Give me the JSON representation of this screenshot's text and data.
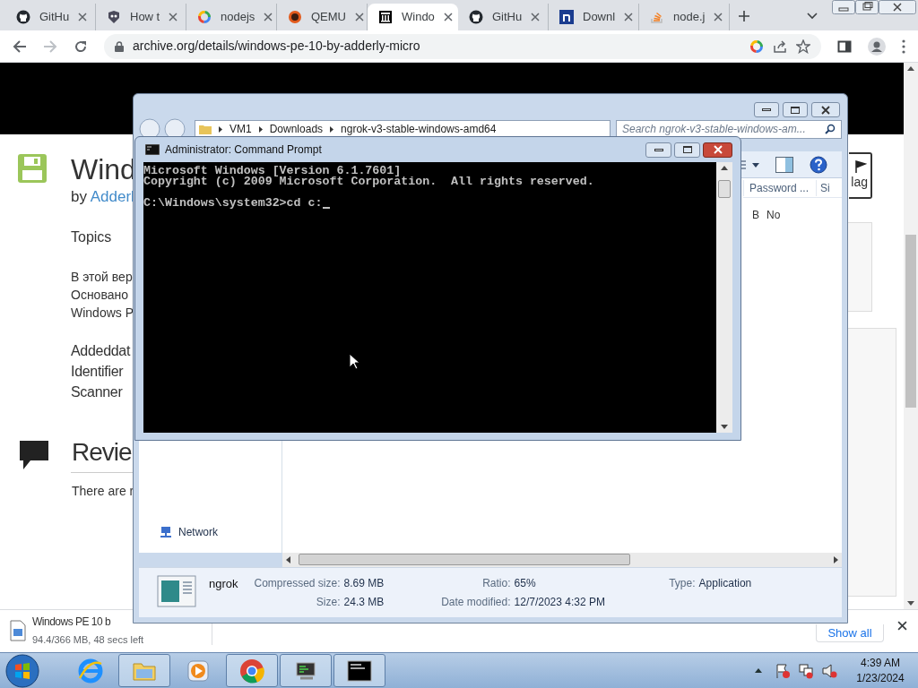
{
  "browser": {
    "tabs": [
      {
        "label": "GitHu",
        "kind": "github",
        "selected": false
      },
      {
        "label": "How t",
        "kind": "mask",
        "selected": false
      },
      {
        "label": "nodejs",
        "kind": "google",
        "selected": false
      },
      {
        "label": "QEMU",
        "kind": "qemu",
        "selected": false
      },
      {
        "label": "Windo",
        "kind": "archive",
        "selected": true
      },
      {
        "label": "GitHu",
        "kind": "github",
        "selected": false
      },
      {
        "label": "Downl",
        "kind": "nsquare",
        "selected": false
      },
      {
        "label": "node.j",
        "kind": "stack",
        "selected": false
      }
    ],
    "address": "archive.org/details/windows-pe-10-by-adderly-micro",
    "page": {
      "title": "Wind",
      "byline": "by",
      "author": "Adderl",
      "topics_label": "Topics",
      "description": [
        "В этой вер",
        "Основано",
        "Windows P"
      ],
      "metadata_labels": [
        "Addeddat",
        "Identifier",
        "Scanner"
      ],
      "reviews_heading": "Revie",
      "reviews_text": "There are r",
      "flag_button": "lag"
    },
    "download": {
      "filename": "Windows PE 10 b",
      "progress": "94.4/366 MB, 48 secs left",
      "show_all": "Show all"
    }
  },
  "explorer": {
    "breadcrumb": [
      "VM1",
      "Downloads",
      "ngrok-v3-stable-windows-amd64"
    ],
    "search_placeholder": "Search ngrok-v3-stable-windows-am...",
    "columns": [
      "Password ...",
      "Si"
    ],
    "row_cells": [
      "B",
      "No"
    ],
    "nav_items": [
      "Network"
    ],
    "details": {
      "name": "ngrok",
      "columns": [
        [
          {
            "label": "Compressed size:",
            "value": "8.69 MB"
          },
          {
            "label": "Size:",
            "value": "24.3 MB"
          }
        ],
        [
          {
            "label": "Ratio:",
            "value": "65%"
          },
          {
            "label": "Date modified:",
            "value": "12/7/2023 4:32 PM"
          }
        ],
        [
          {
            "label": "Type:",
            "value": "Application"
          }
        ]
      ]
    }
  },
  "cmd": {
    "title": "Administrator: Command Prompt",
    "blocks": [
      [
        "Microsoft Windows [Version 6.1.7601]",
        "Copyright (c) 2009 Microsoft Corporation.  All rights reserved."
      ],
      [
        "C:\\Windows\\system32>cd c:"
      ]
    ]
  },
  "taskbar": {
    "items": [
      {
        "kind": "ie",
        "running": false
      },
      {
        "kind": "folder",
        "running": true
      },
      {
        "kind": "media",
        "running": false
      },
      {
        "kind": "chrome",
        "running": true
      },
      {
        "kind": "vm",
        "running": true
      },
      {
        "kind": "console",
        "running": true
      }
    ],
    "time": "4:39 AM",
    "date": "1/23/2024"
  }
}
